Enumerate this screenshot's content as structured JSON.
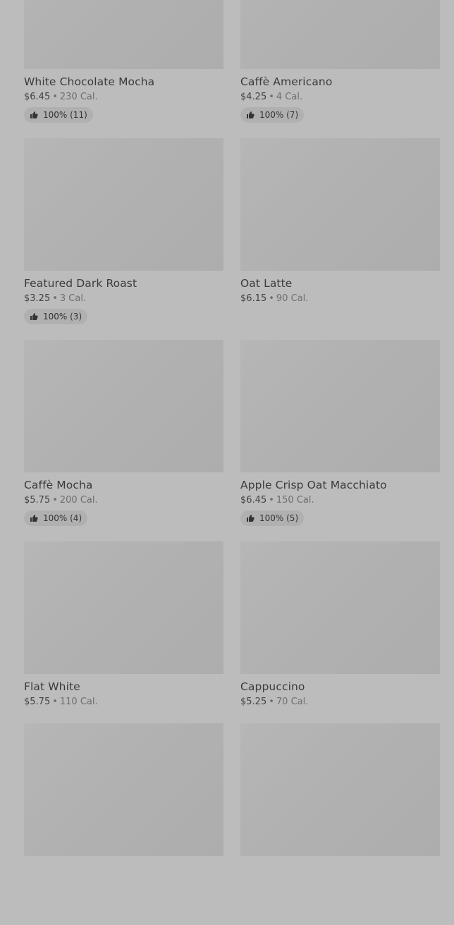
{
  "items": [
    {
      "name": "White Chocolate Mocha",
      "price": "$6.45",
      "separator": "•",
      "calories": "230 Cal.",
      "rating": "100% (11)"
    },
    {
      "name": "Caffè Americano",
      "price": "$4.25",
      "separator": "•",
      "calories": "4 Cal.",
      "rating": "100% (7)"
    },
    {
      "name": "Featured Dark Roast",
      "price": "$3.25",
      "separator": "•",
      "calories": "3 Cal.",
      "rating": "100% (3)"
    },
    {
      "name": "Oat Latte",
      "price": "$6.15",
      "separator": "•",
      "calories": "90 Cal.",
      "rating": null
    },
    {
      "name": "Caffè Mocha",
      "price": "$5.75",
      "separator": "•",
      "calories": "200 Cal.",
      "rating": "100% (4)"
    },
    {
      "name": "Apple Crisp Oat Macchiato",
      "price": "$6.45",
      "separator": "•",
      "calories": "150 Cal.",
      "rating": "100% (5)"
    },
    {
      "name": "Flat White",
      "price": "$5.75",
      "separator": "•",
      "calories": "110 Cal.",
      "rating": null
    },
    {
      "name": "Cappuccino",
      "price": "$5.25",
      "separator": "•",
      "calories": "70 Cal.",
      "rating": null
    },
    {
      "name": "",
      "price": "",
      "separator": "",
      "calories": "",
      "rating": null
    },
    {
      "name": "",
      "price": "",
      "separator": "",
      "calories": "",
      "rating": null
    }
  ],
  "icons": {
    "rating": "thumbs-up-icon"
  },
  "colors": {
    "background": "#bcbcbc",
    "thumbnail": "#b1b1b1",
    "rating_pill": "#b0b0b0",
    "title_text": "#3b3b3b",
    "muted_text": "#6e6e6e"
  }
}
